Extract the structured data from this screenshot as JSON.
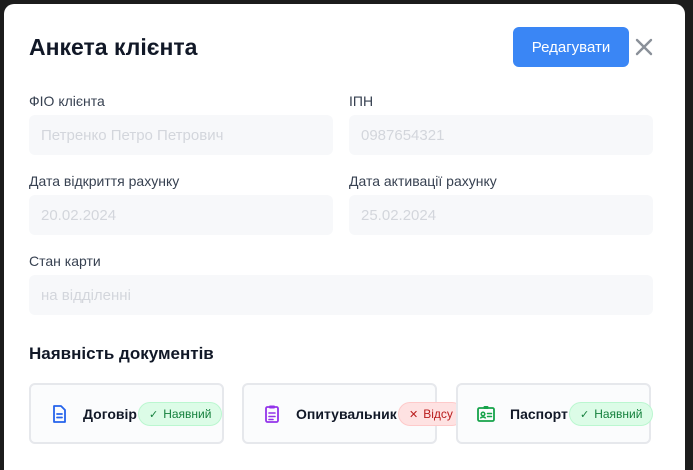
{
  "modal": {
    "title": "Анкета клієнта",
    "edit_label": "Редагувати"
  },
  "fields": [
    {
      "label": "ФІО клієнта",
      "placeholder": "Петренко Петро Петрович"
    },
    {
      "label": "ІПН",
      "placeholder": "0987654321"
    },
    {
      "label": "Дата відкриття рахунку",
      "placeholder": "20.02.2024"
    },
    {
      "label": "Дата активації рахунку",
      "placeholder": "25.02.2024"
    },
    {
      "label": "Стан карти",
      "placeholder": "на відділенні"
    }
  ],
  "documents": {
    "title": "Наявність документів",
    "items": [
      {
        "name": "Договір",
        "status": "Наявний",
        "icon": "document-icon",
        "color": "#2563eb"
      },
      {
        "name": "Опитувальник",
        "status": "Відсу",
        "icon": "clipboard-icon",
        "color": "#9333ea"
      },
      {
        "name": "Паспорт",
        "status": "Наявний",
        "icon": "id-card-icon",
        "color": "#16a34a"
      }
    ]
  },
  "colors": {
    "accent": "#3a86f5",
    "present": "#15803d",
    "absent": "#b91c1c"
  }
}
